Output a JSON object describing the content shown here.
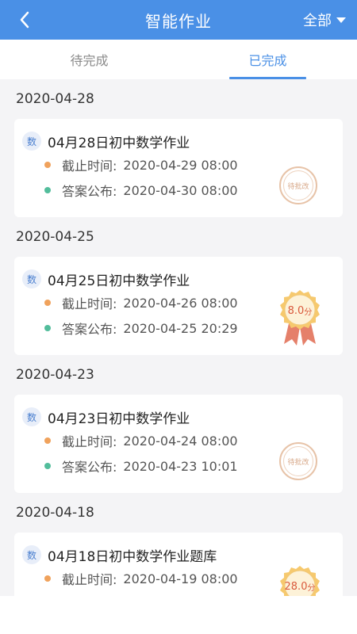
{
  "header": {
    "title": "智能作业",
    "filter_label": "全部"
  },
  "tabs": [
    {
      "label": "待完成",
      "active": false
    },
    {
      "label": "已完成",
      "active": true
    }
  ],
  "groups": [
    {
      "date": "2020-04-28",
      "item": {
        "subject": "数",
        "title": "04月28日初中数学作业",
        "deadline_label": "截止时间:",
        "deadline": "2020-04-29 08:00",
        "answer_label": "答案公布:",
        "answer": "2020-04-30 08:00",
        "status_type": "pending",
        "status_text": "待批改"
      }
    },
    {
      "date": "2020-04-25",
      "item": {
        "subject": "数",
        "title": "04月25日初中数学作业",
        "deadline_label": "截止时间:",
        "deadline": "2020-04-26 08:00",
        "answer_label": "答案公布:",
        "answer": "2020-04-25 20:29",
        "status_type": "score",
        "score": "8.0",
        "score_unit": "分"
      }
    },
    {
      "date": "2020-04-23",
      "item": {
        "subject": "数",
        "title": "04月23日初中数学作业",
        "deadline_label": "截止时间:",
        "deadline": "2020-04-24 08:00",
        "answer_label": "答案公布:",
        "answer": "2020-04-23 10:01",
        "status_type": "pending",
        "status_text": "待批改"
      }
    },
    {
      "date": "2020-04-18",
      "item": {
        "subject": "数",
        "title": "04月18日初中数学作业题库",
        "deadline_label": "截止时间:",
        "deadline": "2020-04-19 08:00",
        "answer_label": "",
        "answer": "",
        "status_type": "score",
        "score": "28.0",
        "score_unit": "分"
      }
    }
  ],
  "colors": {
    "accent": "#4a90e6",
    "deadline_dot": "#f0a25c",
    "answer_dot": "#52bd9b",
    "background": "#f4f4f6"
  }
}
